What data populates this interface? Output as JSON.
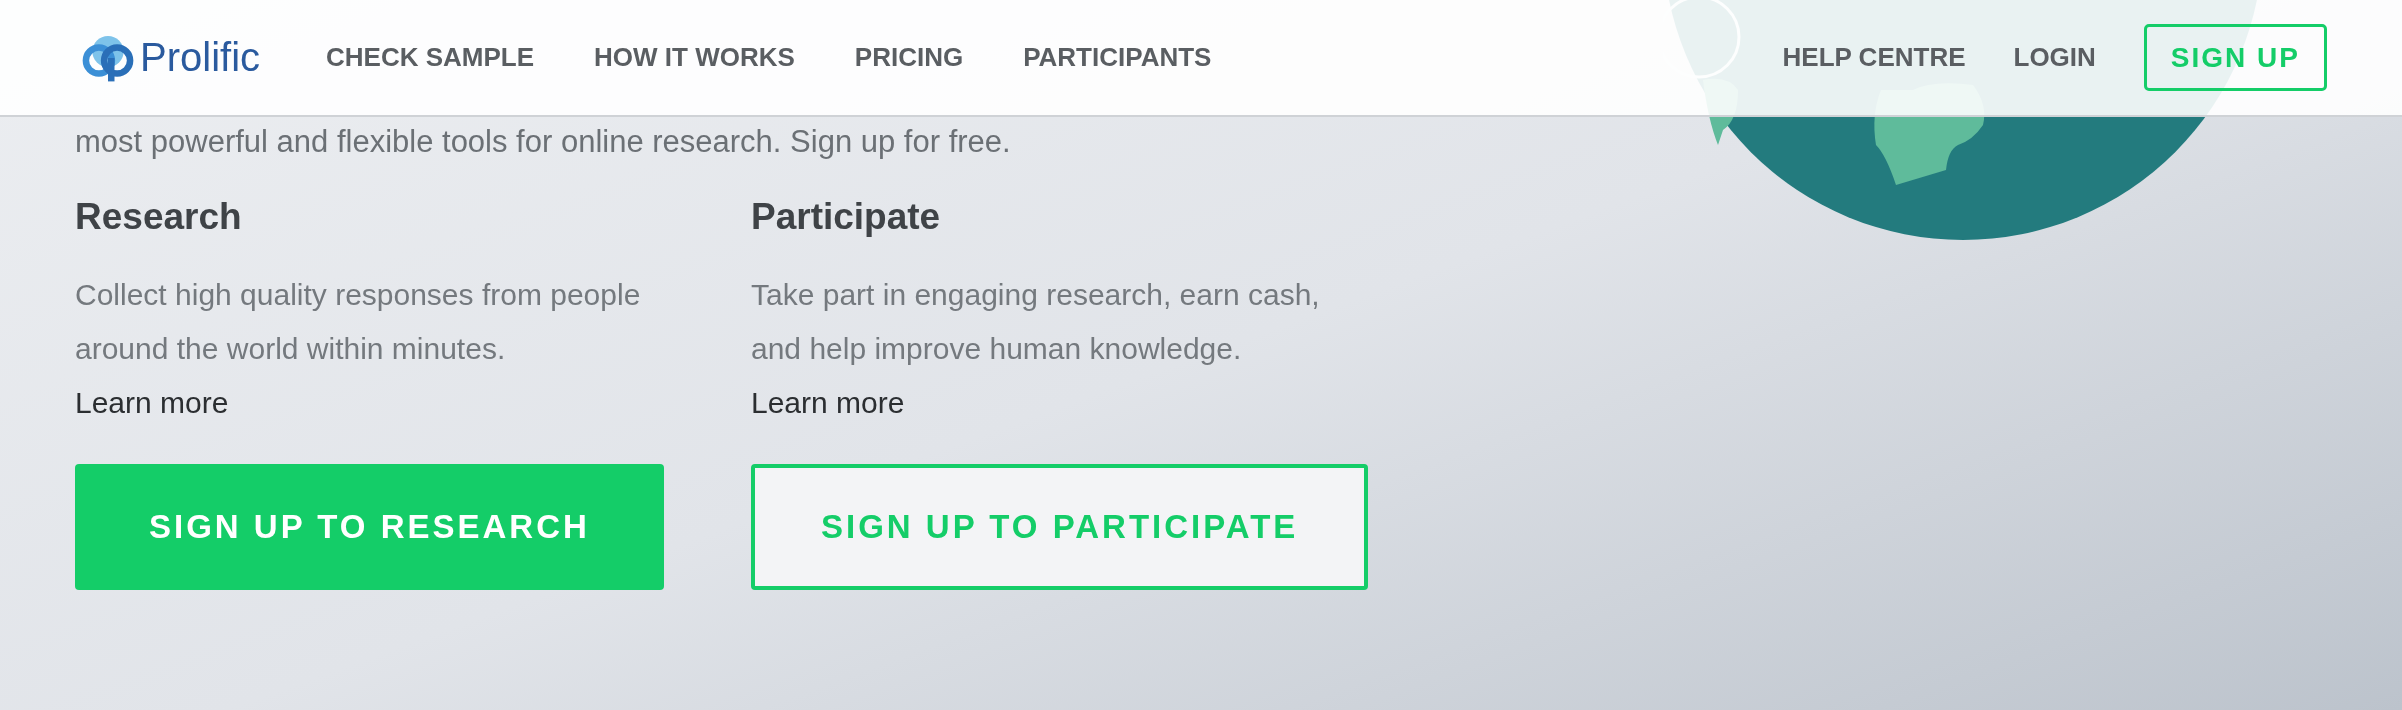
{
  "header": {
    "logo": "Prolific",
    "nav": [
      "CHECK SAMPLE",
      "HOW IT WORKS",
      "PRICING",
      "PARTICIPANTS"
    ],
    "right_nav": [
      "HELP CENTRE",
      "LOGIN"
    ],
    "signup_button": "SIGN UP"
  },
  "intro_text": "most powerful and flexible tools for online research. Sign up for free.",
  "columns": [
    {
      "title": "Research",
      "text": "Collect high quality responses from people around the world within minutes.",
      "link": "Learn more",
      "button": {
        "label": "SIGN UP TO RESEARCH",
        "kind": "filled"
      }
    },
    {
      "title": "Participate",
      "text": "Take part in engaging research, earn cash, and help improve human knowledge.",
      "link": "Learn more",
      "button": {
        "label": "SIGN UP TO PARTICIPATE",
        "kind": "outline"
      }
    }
  ]
}
